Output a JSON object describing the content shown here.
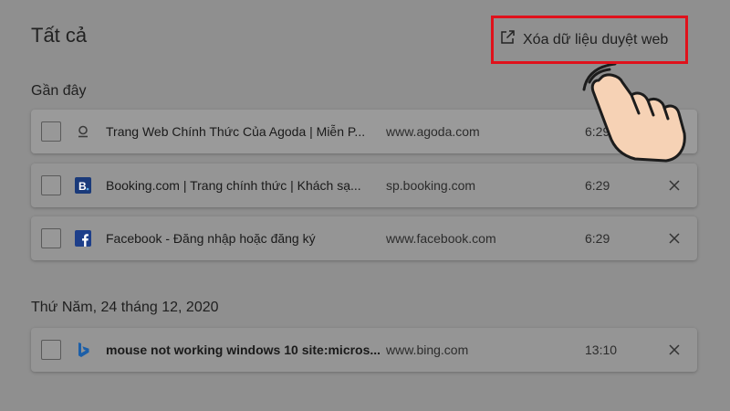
{
  "header": {
    "title": "Tất cả",
    "clear_label": "Xóa dữ liệu duyệt web"
  },
  "sections": [
    {
      "label": "Gần đây",
      "items": [
        {
          "title": "Trang Web Chính Thức Của Agoda | Miễn P...",
          "url": "www.agoda.com",
          "time": "6:29",
          "icon": "agoda-icon"
        },
        {
          "title": "Booking.com | Trang chính thức | Khách sạ...",
          "url": "sp.booking.com",
          "time": "6:29",
          "icon": "booking-icon"
        },
        {
          "title": "Facebook - Đăng nhập hoặc đăng ký",
          "url": "www.facebook.com",
          "time": "6:29",
          "icon": "facebook-icon"
        }
      ]
    },
    {
      "label": "Thứ Năm, 24 tháng 12, 2020",
      "items": [
        {
          "title": "mouse not working windows 10 site:micros...",
          "url": "www.bing.com",
          "time": "13:10",
          "icon": "bing-icon"
        }
      ]
    }
  ],
  "colors": {
    "highlight_border": "#e0111b",
    "booking_blue": "#1a3a7a",
    "facebook_blue": "#1e3f8a",
    "bing_blue": "#1c5fa8"
  }
}
